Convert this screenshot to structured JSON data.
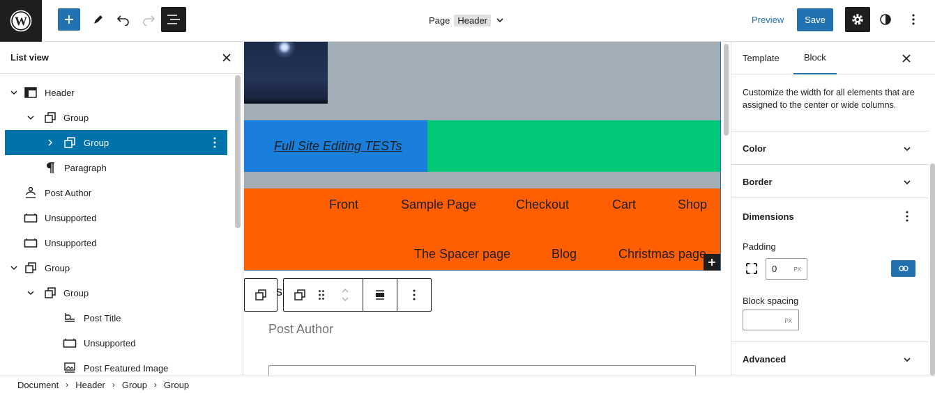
{
  "topbar": {
    "logo_icon": "wordpress-logo",
    "doc_label": "Page",
    "doc_badge": "Header",
    "preview_label": "Preview",
    "save_label": "Save",
    "accent_color": "#2271b1"
  },
  "listview": {
    "title": "List view",
    "items": [
      {
        "label": "Header",
        "icon": "template-part-icon",
        "expand": "down"
      },
      {
        "label": "Group",
        "icon": "group-icon",
        "expand": "down"
      },
      {
        "label": "Group",
        "icon": "group-icon",
        "expand": "right",
        "selected": true
      },
      {
        "label": "Paragraph",
        "icon": "paragraph-icon",
        "expand": "none"
      },
      {
        "label": "Post Author",
        "icon": "post-author-icon",
        "expand": "none"
      },
      {
        "label": "Unsupported",
        "icon": "unsupported-icon",
        "expand": "none"
      },
      {
        "label": "Unsupported",
        "icon": "unsupported-icon",
        "expand": "none"
      },
      {
        "label": "Group",
        "icon": "group-icon",
        "expand": "down"
      },
      {
        "label": "Group",
        "icon": "group-icon",
        "expand": "down"
      },
      {
        "label": "Post Title",
        "icon": "post-title-icon",
        "expand": "none"
      },
      {
        "label": "Unsupported",
        "icon": "unsupported-icon",
        "expand": "none"
      },
      {
        "label": "Post Featured Image",
        "icon": "featured-image-icon",
        "expand": "none"
      }
    ]
  },
  "canvas": {
    "site_title": "Full Site Editing TESTs",
    "nav_row1": [
      "Front",
      "Sample Page",
      "Checkout",
      "Cart",
      "Shop"
    ],
    "nav_row2": [
      "The Spacer page",
      "Blog",
      "Christmas page"
    ],
    "behind_text": "s",
    "post_author": "Post Author",
    "colors": {
      "header_bg": "#a2adb6",
      "title_bg": "#1a7fdc",
      "green": "#00c878",
      "nav_bg": "#ff5f00"
    }
  },
  "sidebar": {
    "tabs": [
      "Template",
      "Block"
    ],
    "active_tab": "Block",
    "description": "Customize the width for all elements that are assigned to the center or wide columns.",
    "panels": [
      "Color",
      "Border"
    ],
    "dimensions": {
      "title": "Dimensions",
      "padding_label": "Padding",
      "padding_value": "0",
      "padding_unit": "PX",
      "block_spacing_label": "Block spacing",
      "block_spacing_unit": "PX"
    },
    "advanced": "Advanced"
  },
  "breadcrumb": [
    "Document",
    "Header",
    "Group",
    "Group"
  ]
}
